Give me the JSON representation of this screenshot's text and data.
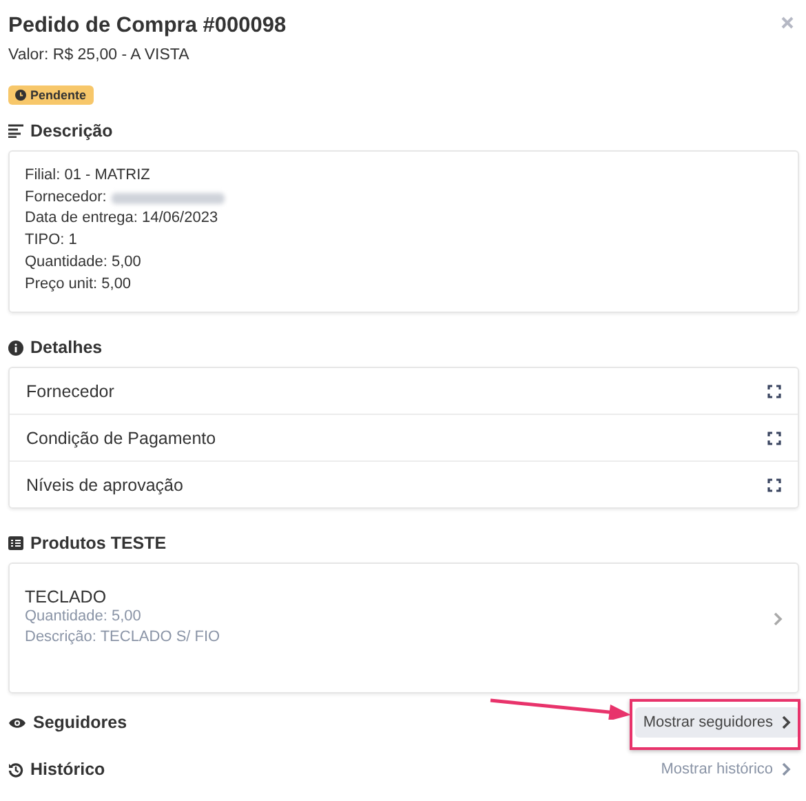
{
  "header": {
    "title": "Pedido de Compra #000098",
    "subtitle": "Valor: R$ 25,00 - A VISTA",
    "status": "Pendente"
  },
  "descricao": {
    "title": "Descrição",
    "lines": [
      {
        "label": "Filial: 01 - MATRIZ",
        "redacted": false
      },
      {
        "label": "Fornecedor:",
        "redacted": true
      },
      {
        "label": "Data de entrega: 14/06/2023",
        "redacted": false
      },
      {
        "label": "TIPO: 1",
        "redacted": false
      },
      {
        "label": "Quantidade: 5,00",
        "redacted": false
      },
      {
        "label": "Preço unit: 5,00",
        "redacted": false
      }
    ]
  },
  "detalhes": {
    "title": "Detalhes",
    "items": [
      "Fornecedor",
      "Condição de Pagamento",
      "Níveis de aprovação"
    ]
  },
  "produtos": {
    "title": "Produtos TESTE",
    "items": [
      {
        "name": "TECLADO",
        "details": [
          "Quantidade: 5,00",
          "Descrição: TECLADO S/ FIO"
        ]
      }
    ]
  },
  "sections": [
    {
      "kind": "followers",
      "title": "Seguidores",
      "action": "Mostrar seguidores",
      "highlighted": true
    },
    {
      "kind": "history",
      "title": "Histórico",
      "action": "Mostrar histórico",
      "highlighted": false
    }
  ]
}
